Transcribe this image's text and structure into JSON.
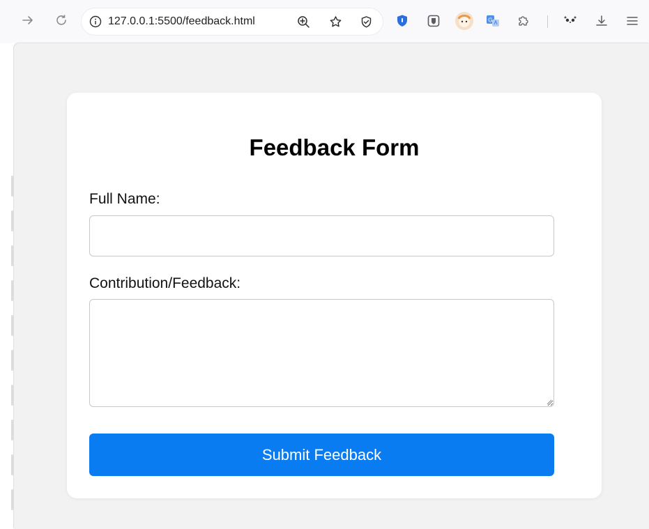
{
  "browser": {
    "url": "127.0.0.1:5500/feedback.html",
    "icons": [
      "forward-arrow-icon",
      "reload-icon",
      "info-icon",
      "zoom-icon",
      "bookmark-star-icon",
      "shield-check-icon",
      "ublock-shield-icon",
      "bitwarden-icon",
      "avatar-extension-icon",
      "translate-icon",
      "extensions-puzzle-icon",
      "panda-extension-icon",
      "download-icon",
      "menu-icon"
    ],
    "accent": "#0a7cf2"
  },
  "form": {
    "title": "Feedback Form",
    "name_label": "Full Name:",
    "name_value": "",
    "feedback_label": "Contribution/Feedback:",
    "feedback_value": "",
    "submit_label": "Submit Feedback"
  }
}
